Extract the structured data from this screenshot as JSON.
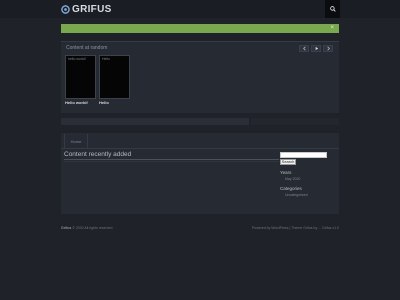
{
  "header": {
    "logo_text": "GRIFUS",
    "search_icon": "search-icon",
    "logo_icon": "gear-logo-icon"
  },
  "notice": {
    "close_label": "×"
  },
  "carousel": {
    "title": "Content at random",
    "controls": [
      "prev-icon",
      "play-icon",
      "next-icon"
    ],
    "items": [
      {
        "thumb_text": "hello world!",
        "label": "Hello world!"
      },
      {
        "thumb_text": "Hello",
        "label": "Hello"
      }
    ]
  },
  "content": {
    "tab_label": "Home",
    "section_title": "Content recently added"
  },
  "sidebar": {
    "search_button": "Search",
    "years_title": "Years",
    "years_link": "May 2020",
    "categories_title": "Categories",
    "categories_link": "Uncategorized"
  },
  "footer": {
    "site": "Grifus",
    "left_text": " © 2020 All rights reserved",
    "right_text": "Powered by WordPress | Theme Grifus by ... Grifus v1.0"
  },
  "colors": {
    "accent_green": "#7aa84e",
    "background": "#1f2229",
    "panel": "#262a33"
  }
}
